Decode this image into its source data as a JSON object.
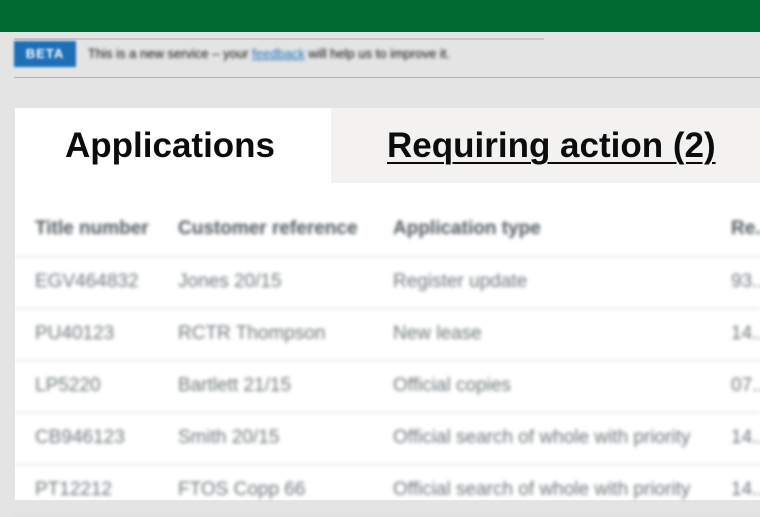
{
  "header": {
    "bar_color": "#00692f"
  },
  "banner": {
    "tag": "BETA",
    "text_before": "This is a new service – your",
    "link": "feedback",
    "text_after": "will help us to improve it."
  },
  "tabs": [
    {
      "label": "Applications",
      "active": true
    },
    {
      "label": "Requiring action (2)",
      "active": false
    }
  ],
  "table": {
    "columns": [
      "Title number",
      "Customer reference",
      "Application type",
      "Re..."
    ],
    "rows": [
      [
        "EGV464832",
        "Jones 20/15",
        "Register update",
        "93..."
      ],
      [
        "PU40123",
        "RCTR Thompson",
        "New lease",
        "14..."
      ],
      [
        "LP5220",
        "Bartlett 21/15",
        "Official copies",
        "07..."
      ],
      [
        "CB946123",
        "Smith 20/15",
        "Official search of whole with priority",
        "14..."
      ],
      [
        "PT12212",
        "FTOS Copp 66",
        "Official search of whole with priority",
        "14..."
      ]
    ]
  }
}
